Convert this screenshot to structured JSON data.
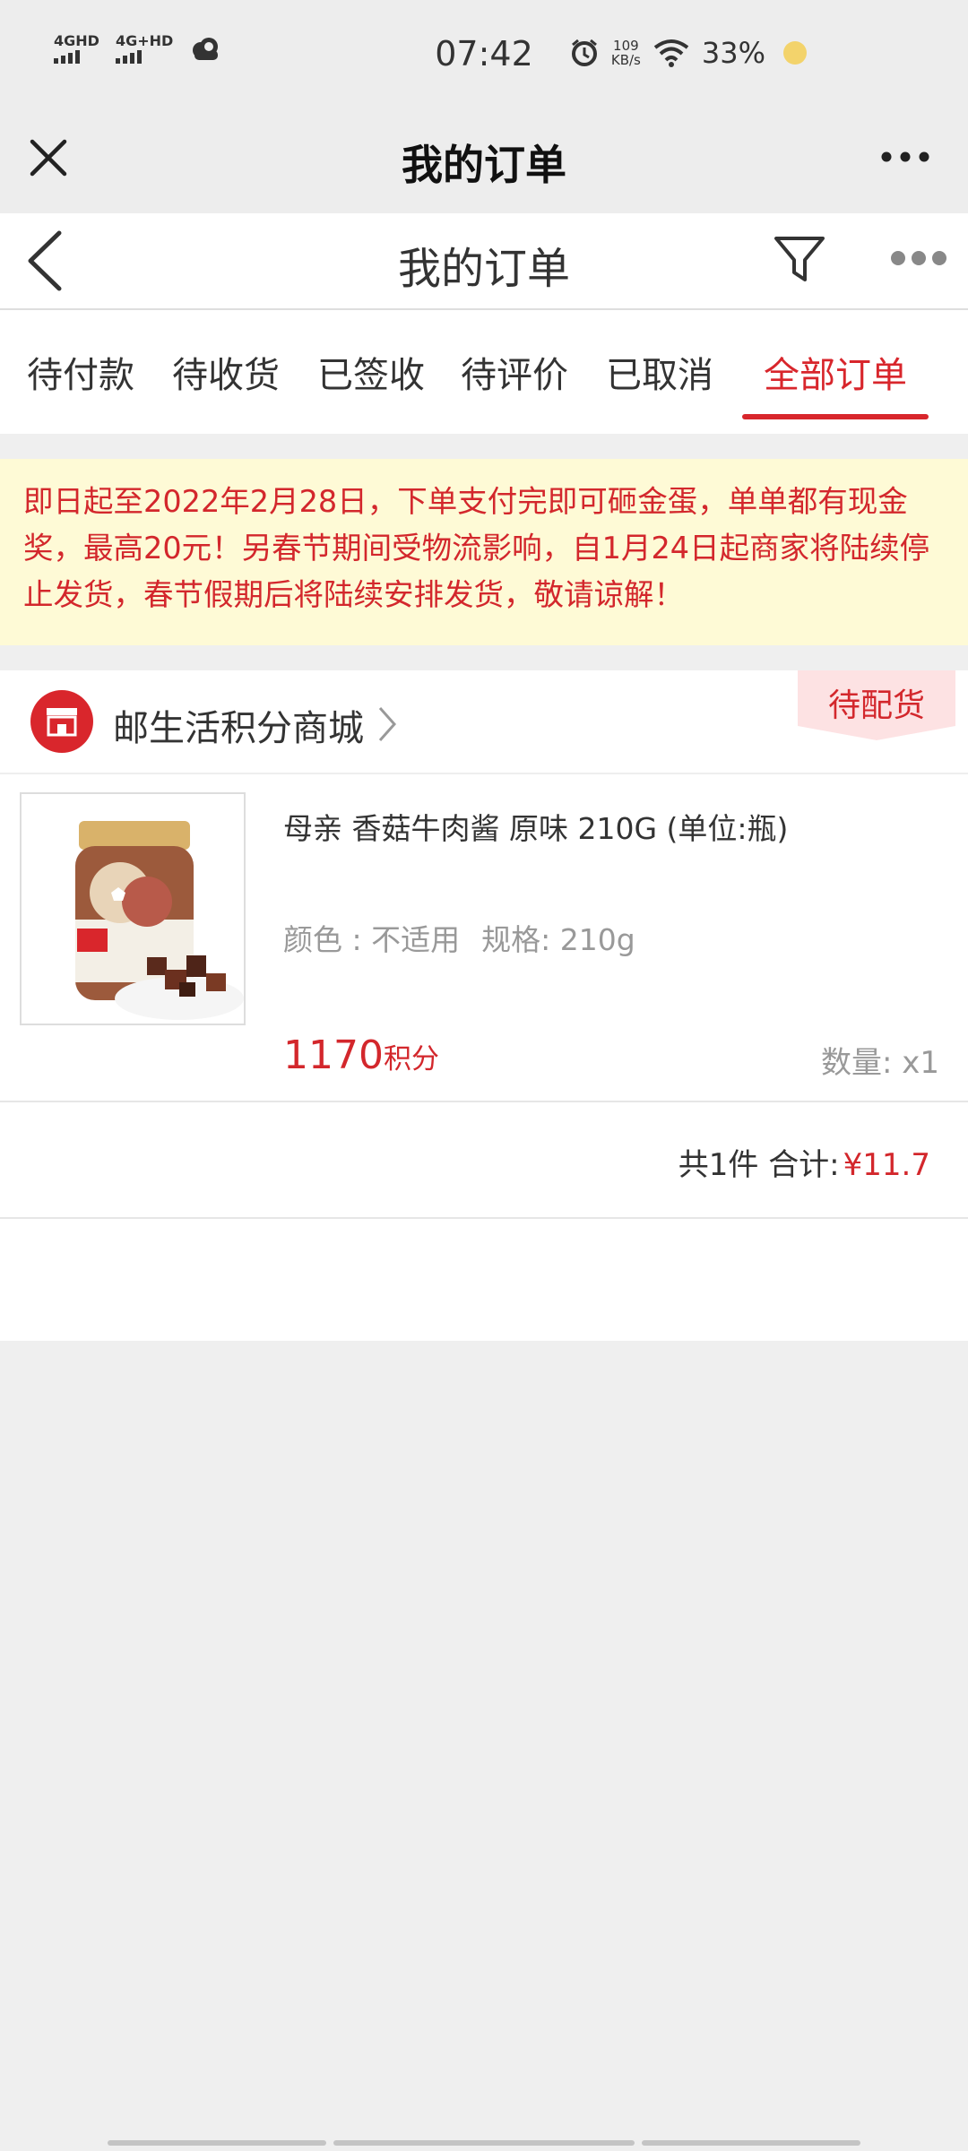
{
  "status_bar": {
    "net1": "4GHD",
    "net2": "4G+HD",
    "time": "07:42",
    "speed_value": "109",
    "speed_unit": "KB/s",
    "battery": "33%"
  },
  "wechat_bar": {
    "title": "我的订单"
  },
  "page_header": {
    "title": "我的订单"
  },
  "tabs": [
    {
      "label": "待付款"
    },
    {
      "label": "待收货"
    },
    {
      "label": "已签收"
    },
    {
      "label": "待评价"
    },
    {
      "label": "已取消"
    },
    {
      "label": "全部订单",
      "active": true
    }
  ],
  "notice": {
    "text": "即日起至2022年2月28日，下单支付完即可砸金蛋，单单都有现金奖，最高20元！另春节期间受物流影响，自1月24日起商家将陆续停止发货，春节假期后将陆续安排发货，敬请谅解！"
  },
  "order": {
    "shop_name": "邮生活积分商城",
    "status": "待配货",
    "item": {
      "title": "母亲 香菇牛肉酱 原味 210G (单位:瓶)",
      "color": "颜色 : 不适用",
      "spec": "规格: 210g",
      "price": "1170",
      "price_unit": "积分",
      "qty": "数量:  x1"
    },
    "summary": {
      "count": "共1件",
      "label": "合计:",
      "amount": "¥11.7"
    }
  },
  "colors": {
    "accent": "#d8262c",
    "notice_bg": "#fefad6",
    "page_bg": "#efefef"
  }
}
